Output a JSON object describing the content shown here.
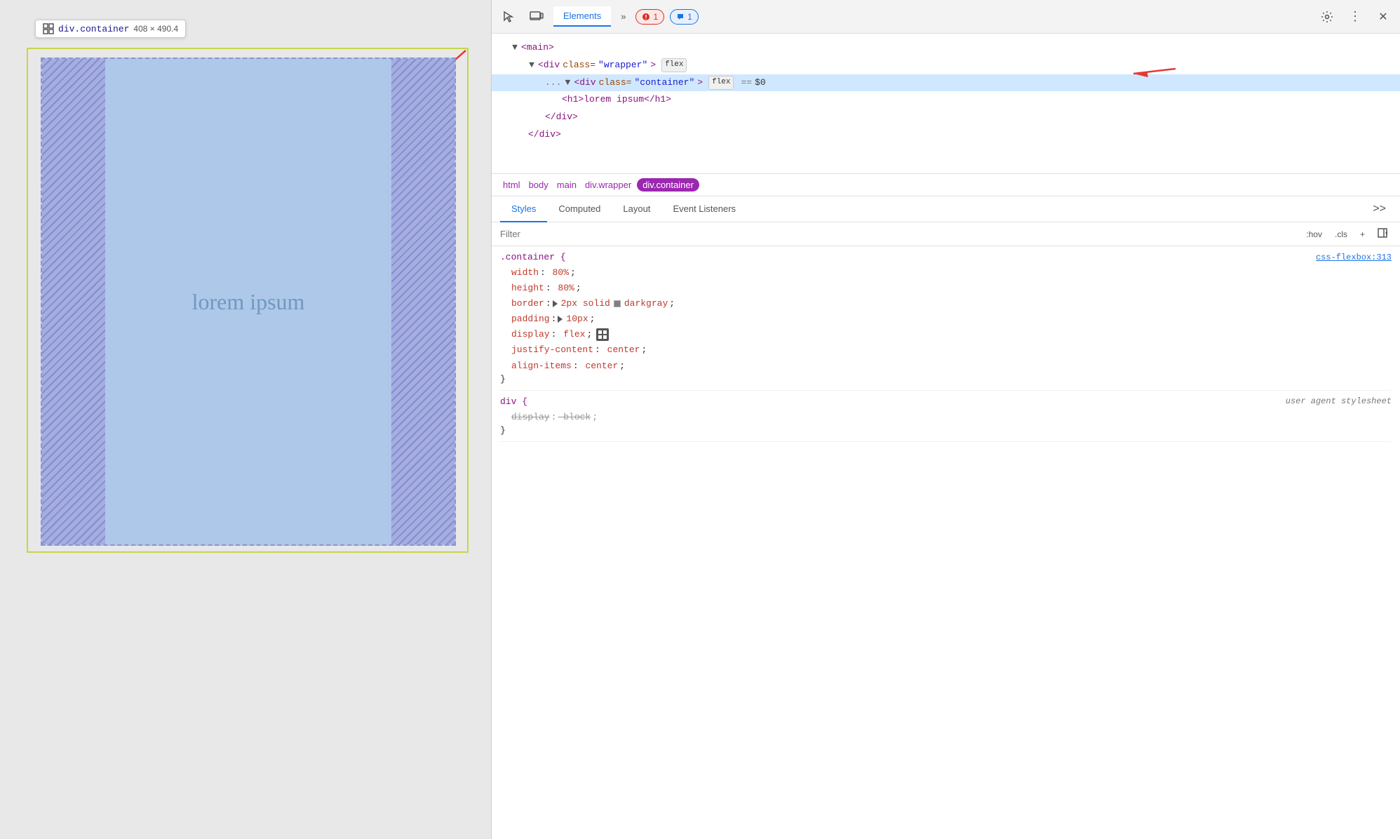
{
  "tooltip": {
    "element": "div.container",
    "dimensions": "408 × 490.4",
    "icon": "⊞"
  },
  "dom_tree": {
    "nodes": [
      {
        "id": "main",
        "indent": 1,
        "text": "▼<main>",
        "selected": false
      },
      {
        "id": "wrapper",
        "indent": 2,
        "text": "▼<div class=\"wrapper\">",
        "badge": "flex",
        "selected": false
      },
      {
        "id": "container",
        "indent": 3,
        "text": "▼<div class=\"container\">",
        "badge": "flex",
        "equals": "== $0",
        "selected": true
      },
      {
        "id": "h1",
        "indent": 4,
        "text": "<h1>lorem ipsum</h1>",
        "selected": false
      },
      {
        "id": "close-div1",
        "indent": 3,
        "text": "</div>",
        "selected": false
      },
      {
        "id": "close-div2",
        "indent": 2,
        "text": "</div>",
        "selected": false
      }
    ]
  },
  "breadcrumb": {
    "items": [
      {
        "label": "html",
        "active": false
      },
      {
        "label": "body",
        "active": false
      },
      {
        "label": "main",
        "active": false
      },
      {
        "label": "div.wrapper",
        "active": false
      },
      {
        "label": "div.container",
        "active": true
      }
    ]
  },
  "tabs": {
    "items": [
      "Styles",
      "Computed",
      "Layout",
      "Event Listeners",
      ">>"
    ]
  },
  "filter": {
    "placeholder": "Filter",
    "hov_label": ":hov",
    "cls_label": ".cls",
    "plus_label": "+",
    "arrow_label": "◄"
  },
  "styles": {
    "rules": [
      {
        "selector": ".container {",
        "source": "css-flexbox:313",
        "source_type": "link",
        "properties": [
          {
            "prop": "width",
            "value": "80%",
            "has_triangle": false
          },
          {
            "prop": "height",
            "value": "80%",
            "has_triangle": false
          },
          {
            "prop": "border",
            "value": "2px solid  darkgray",
            "has_swatch": true,
            "has_triangle": true
          },
          {
            "prop": "padding",
            "value": "10px",
            "has_triangle": true
          },
          {
            "prop": "display",
            "value": "flex",
            "has_flex_icon": true
          },
          {
            "prop": "justify-content",
            "value": "center"
          },
          {
            "prop": "align-items",
            "value": "center"
          }
        ]
      },
      {
        "selector": "div {",
        "source": "user agent stylesheet",
        "source_type": "italic",
        "properties": [
          {
            "prop": "display",
            "value": "block",
            "strikethrough": true
          }
        ]
      }
    ]
  },
  "toolbar": {
    "cursor_icon": "↖",
    "device_icon": "▭",
    "tab_elements": "Elements",
    "more_tabs": "»",
    "error_count": "1",
    "chat_count": "1",
    "gear_icon": "⚙",
    "more_icon": "⋮",
    "close_icon": "✕"
  },
  "lorem_text": "lorem ipsum",
  "colors": {
    "accent_blue": "#1a73e8",
    "purple_tag": "#881280",
    "attr_name": "#994400",
    "attr_value": "#1a1acc",
    "css_red": "#c0392b",
    "selected_bg": "#d0e8ff"
  }
}
